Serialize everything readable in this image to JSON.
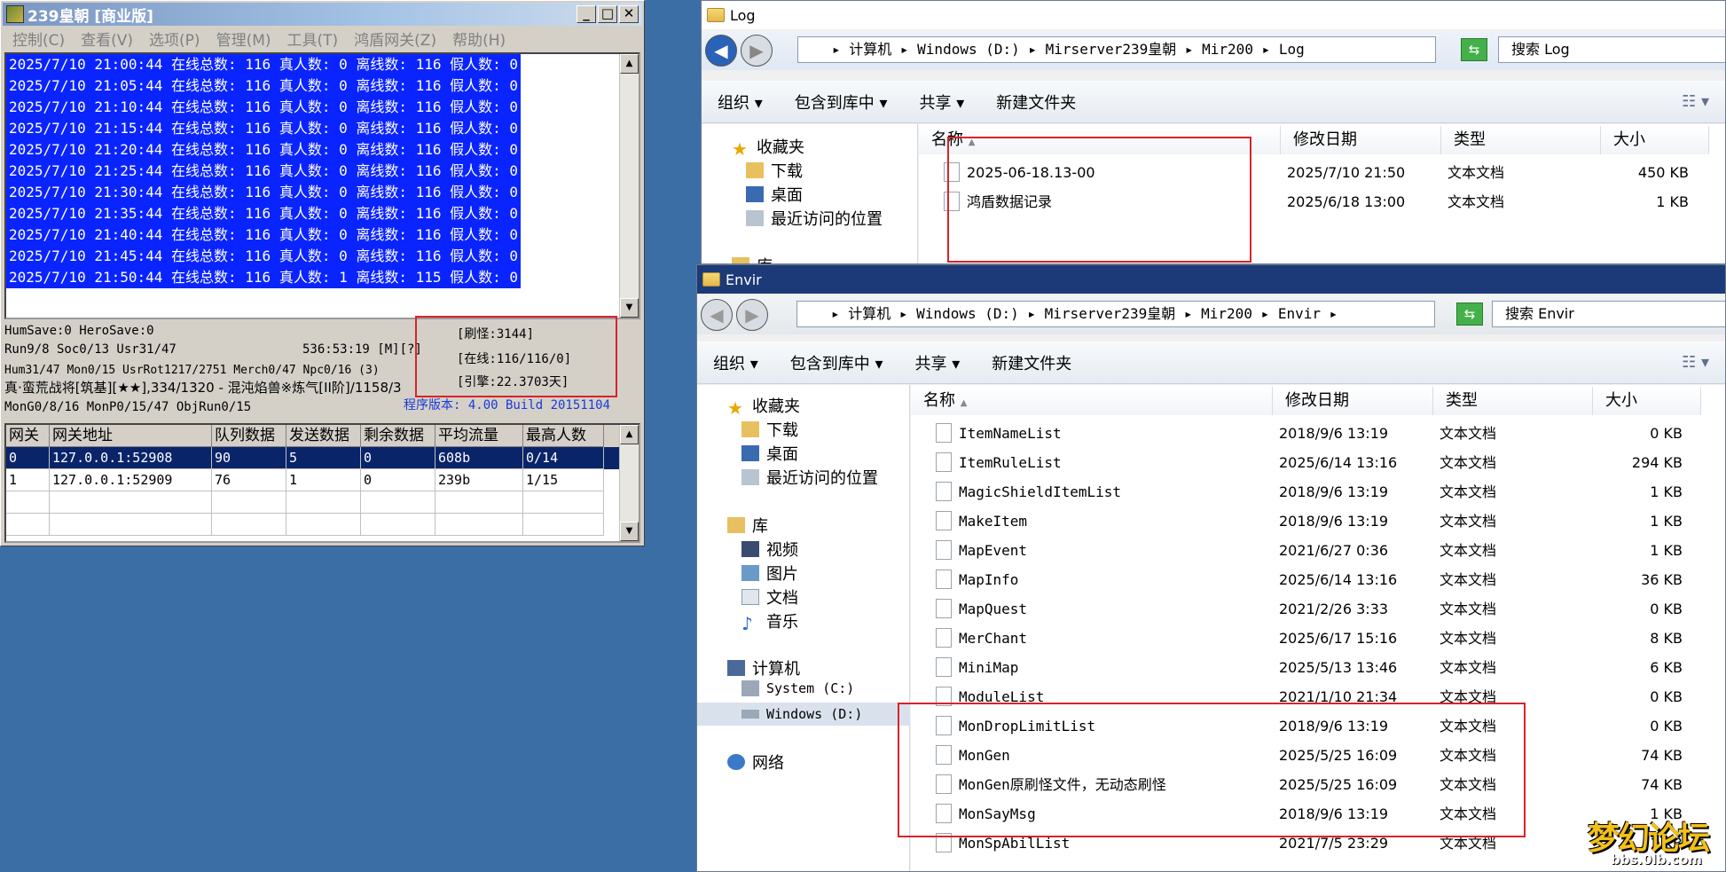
{
  "server": {
    "title": "239皇朝 [商业版]",
    "menu": [
      "控制(C)",
      "查看(V)",
      "选项(P)",
      "管理(M)",
      "工具(T)",
      "鸿盾网关(Z)",
      "帮助(H)"
    ],
    "log": [
      "2025/7/10 21:00:44 在线总数: 116 真人数: 0 离线数: 116 假人数: 0",
      "2025/7/10 21:05:44 在线总数: 116 真人数: 0 离线数: 116 假人数: 0",
      "2025/7/10 21:10:44 在线总数: 116 真人数: 0 离线数: 116 假人数: 0",
      "2025/7/10 21:15:44 在线总数: 116 真人数: 0 离线数: 116 假人数: 0",
      "2025/7/10 21:20:44 在线总数: 116 真人数: 0 离线数: 116 假人数: 0",
      "2025/7/10 21:25:44 在线总数: 116 真人数: 0 离线数: 116 假人数: 0",
      "2025/7/10 21:30:44 在线总数: 116 真人数: 0 离线数: 116 假人数: 0",
      "2025/7/10 21:35:44 在线总数: 116 真人数: 0 离线数: 116 假人数: 0",
      "2025/7/10 21:40:44 在线总数: 116 真人数: 0 离线数: 116 假人数: 0",
      "2025/7/10 21:45:44 在线总数: 116 真人数: 0 离线数: 116 假人数: 0",
      "2025/7/10 21:50:44 在线总数: 116 真人数: 1 离线数: 115 假人数: 0"
    ],
    "status": {
      "line1": "HumSave:0 HeroSave:0",
      "line2": "Run9/8 Soc0/13 Usr31/47",
      "runtime": "536:53:19 [M][?]",
      "line3": "Hum31/47 Mon0/15 UsrRot1217/2751 Merch0/47 Npc0/16 (3)",
      "line4": "真·蛮荒战将[筑基][★★],334/1320 - 混沌焰兽※炼气[II阶]/1158/3",
      "line5": "MonG0/8/16 MonP0/15/47 ObjRun0/15",
      "refresh": "[刷怪:3144]",
      "online": "[在线:116/116/0]",
      "engine": "[引擎:22.3703天]",
      "version": "程序版本: 4.00 Build 20151104"
    },
    "grid": {
      "headers": [
        "网关",
        "网关地址",
        "队列数据",
        "发送数据",
        "剩余数据",
        "平均流量",
        "最高人数"
      ],
      "rows": [
        [
          "0",
          "127.0.0.1:52908",
          "90",
          "5",
          "0",
          "608b",
          "0/14"
        ],
        [
          "1",
          "127.0.0.1:52909",
          "76",
          "1",
          "0",
          "239b",
          "1/15"
        ]
      ]
    }
  },
  "log_window": {
    "title": "Log",
    "address": "▸ 计算机 ▸ Windows (D:) ▸ Mirserver239皇朝 ▸ Mir200 ▸ Log",
    "search": "搜索 Log",
    "toolbar": [
      "组织 ▾",
      "包含到库中 ▾",
      "共享 ▾",
      "新建文件夹"
    ],
    "nav": [
      "收藏夹",
      "下载",
      "桌面",
      "最近访问的位置",
      "库"
    ],
    "columns": [
      "名称",
      "修改日期",
      "类型",
      "大小"
    ],
    "files": [
      {
        "name": "2025-06-18.13-00",
        "date": "2025/7/10 21:50",
        "type": "文本文档",
        "size": "450 KB"
      },
      {
        "name": "鸿盾数据记录",
        "date": "2025/6/18 13:00",
        "type": "文本文档",
        "size": "1 KB"
      }
    ]
  },
  "envir_window": {
    "title": "Envir",
    "address": "▸ 计算机 ▸ Windows (D:) ▸ Mirserver239皇朝 ▸ Mir200 ▸ Envir ▸",
    "search": "搜索 Envir",
    "toolbar": [
      "组织 ▾",
      "包含到库中 ▾",
      "共享 ▾",
      "新建文件夹"
    ],
    "nav": [
      "收藏夹",
      "下载",
      "桌面",
      "最近访问的位置",
      "库",
      "视频",
      "图片",
      "文档",
      "音乐",
      "计算机",
      "System (C:)",
      "Windows (D:)",
      "网络"
    ],
    "columns": [
      "名称",
      "修改日期",
      "类型",
      "大小"
    ],
    "files": [
      {
        "name": "ItemNameList",
        "date": "2018/9/6 13:19",
        "type": "文本文档",
        "size": "0 KB"
      },
      {
        "name": "ItemRuleList",
        "date": "2025/6/14 13:16",
        "type": "文本文档",
        "size": "294 KB"
      },
      {
        "name": "MagicShieldItemList",
        "date": "2018/9/6 13:19",
        "type": "文本文档",
        "size": "1 KB"
      },
      {
        "name": "MakeItem",
        "date": "2018/9/6 13:19",
        "type": "文本文档",
        "size": "1 KB"
      },
      {
        "name": "MapEvent",
        "date": "2021/6/27 0:36",
        "type": "文本文档",
        "size": "1 KB"
      },
      {
        "name": "MapInfo",
        "date": "2025/6/14 13:16",
        "type": "文本文档",
        "size": "36 KB"
      },
      {
        "name": "MapQuest",
        "date": "2021/2/26 3:33",
        "type": "文本文档",
        "size": "0 KB"
      },
      {
        "name": "MerChant",
        "date": "2025/6/17 15:16",
        "type": "文本文档",
        "size": "8 KB"
      },
      {
        "name": "MiniMap",
        "date": "2025/5/13 13:46",
        "type": "文本文档",
        "size": "6 KB"
      },
      {
        "name": "ModuleList",
        "date": "2021/1/10 21:34",
        "type": "文本文档",
        "size": "0 KB"
      },
      {
        "name": "MonDropLimitList",
        "date": "2018/9/6 13:19",
        "type": "文本文档",
        "size": "0 KB"
      },
      {
        "name": "MonGen",
        "date": "2025/5/25 16:09",
        "type": "文本文档",
        "size": "74 KB"
      },
      {
        "name": "MonGen原刷怪文件，无动态刷怪",
        "date": "2025/5/25 16:09",
        "type": "文本文档",
        "size": "74 KB"
      },
      {
        "name": "MonSayMsg",
        "date": "2018/9/6 13:19",
        "type": "文本文档",
        "size": "1 KB"
      },
      {
        "name": "MonSpAbilList",
        "date": "2021/7/5 23:29",
        "type": "文本文档",
        "size": "1 KB"
      }
    ]
  },
  "watermark": {
    "logo": "梦幻论坛",
    "url": "bbs.0lb.com"
  }
}
